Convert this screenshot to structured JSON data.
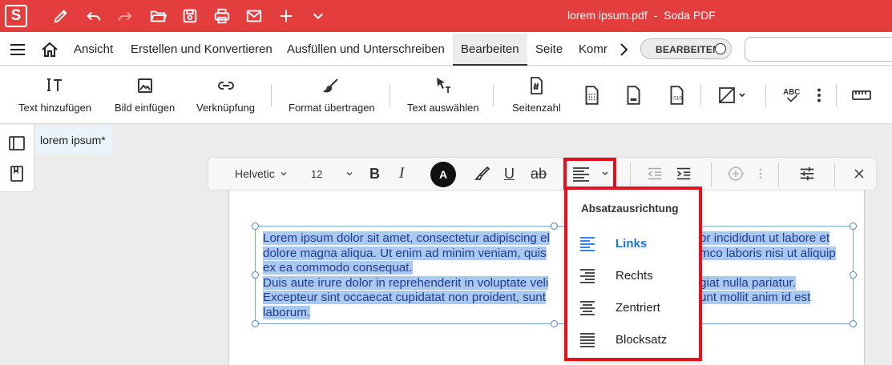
{
  "window": {
    "file_name": "lorem ipsum.pdf",
    "separator": "-",
    "app_name": "Soda PDF",
    "logo_letter": "S",
    "titlebar_color": "#e33d3d"
  },
  "quick_access": [
    {
      "icon": "pen-icon"
    },
    {
      "icon": "undo-icon"
    },
    {
      "icon": "redo-icon"
    },
    {
      "icon": "folder-open-icon"
    },
    {
      "icon": "save-icon"
    },
    {
      "icon": "print-icon"
    },
    {
      "icon": "mail-icon"
    },
    {
      "icon": "plus-icon"
    },
    {
      "icon": "chevron-down-icon"
    }
  ],
  "menu": {
    "items": [
      "Ansicht",
      "Erstellen und Konvertieren",
      "Ausfüllen und Unterschreiben",
      "Bearbeiten",
      "Seite",
      "Komr"
    ],
    "active": "Bearbeiten",
    "toggle_label": "BEARBEITEN"
  },
  "ribbon": {
    "add_text": "Text hinzufügen",
    "insert_image": "Bild einfügen",
    "link": "Verknüpfung",
    "format_painter": "Format übertragen",
    "select_text": "Text auswählen",
    "page_number": "Seitenzahl"
  },
  "document": {
    "tab_label": "lorem ipsum",
    "modified_marker": "*"
  },
  "format_toolbar": {
    "font": "Helvetic",
    "size": "12",
    "color_letter": "A",
    "bold": "B",
    "italic": "I",
    "underline": "U",
    "strike": "ab"
  },
  "textbox": {
    "lines": [
      "Lorem ipsum dolor sit amet, consectetur adipiscing el",
      "dolore magna aliqua. Ut enim ad minim veniam, quis",
      "ex ea commodo consequat.",
      "Duis aute irure dolor in reprehenderit in voluptate veli",
      "Excepteur sint occaecat cupidatat non proident, sunt",
      "laborum."
    ],
    "lines_right": [
      "or incididunt ut labore et",
      "mco laboris nisi ut aliquip",
      "",
      "giat nulla pariatur.",
      "unt mollit anim id est",
      ""
    ],
    "highlight_color": "#a9c9ee",
    "text_color": "#1f3a93"
  },
  "align_dropdown": {
    "heading": "Absatzausrichtung",
    "options": [
      {
        "label": "Links",
        "icon": "align-left-icon",
        "selected": true
      },
      {
        "label": "Rechts",
        "icon": "align-right-icon",
        "selected": false
      },
      {
        "label": "Zentriert",
        "icon": "align-center-icon",
        "selected": false
      },
      {
        "label": "Blocksatz",
        "icon": "align-justify-icon",
        "selected": false
      }
    ],
    "selected_color": "#1a73e8",
    "highlight_border": "#e8101a"
  }
}
